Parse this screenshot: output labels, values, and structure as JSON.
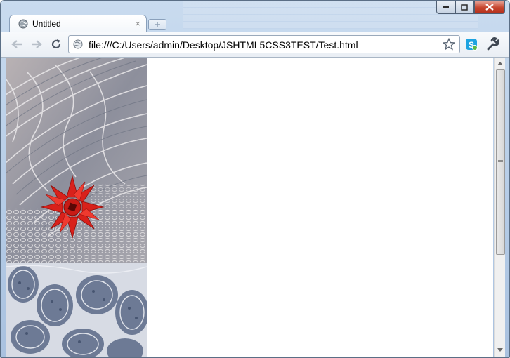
{
  "window": {
    "controls": [
      "minimize",
      "maximize",
      "close"
    ]
  },
  "tab": {
    "title": "Untitled",
    "close_glyph": "×",
    "favicon": "globe-icon"
  },
  "toolbar": {
    "back": "back-arrow-icon",
    "forward": "forward-arrow-icon",
    "reload": "reload-icon",
    "url": "file:///C:/Users/admin/Desktop/JSHTML5CSS3TEST/Test.html",
    "bookmark": "star-icon",
    "extension": "skype-extension-icon",
    "menu": "wrench-icon"
  },
  "page": {
    "images": [
      {
        "name": "marbled-texture-image",
        "desc_icon": "red-gift-bow"
      },
      {
        "name": "cellular-texture-image"
      }
    ]
  },
  "colors": {
    "frame": "#b4cbe6",
    "close_button": "#c7452e",
    "bow_red": "#d8211b"
  }
}
